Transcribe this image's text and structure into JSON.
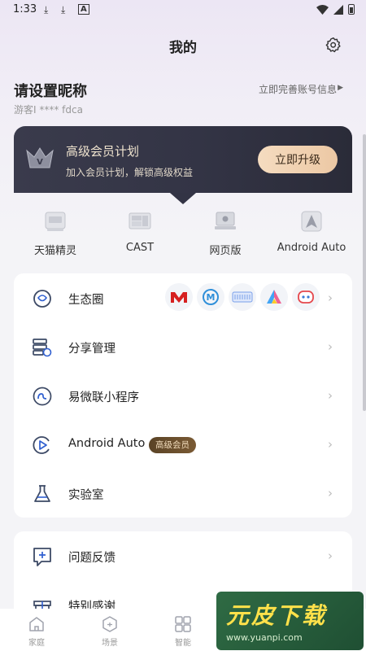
{
  "status_bar": {
    "time": "1:33"
  },
  "header": {
    "title": "我的"
  },
  "profile": {
    "nickname": "请设置昵称",
    "guest_id": "游客I **** fdca",
    "complete_link": "立即完善账号信息"
  },
  "vip": {
    "title": "高级会员计划",
    "subtitle": "加入会员计划，解锁高级权益",
    "button": "立即升级"
  },
  "quick_links": [
    {
      "label": "天猫精灵",
      "icon": "tmall-genie-icon"
    },
    {
      "label": "CAST",
      "icon": "cast-icon"
    },
    {
      "label": "网页版",
      "icon": "web-version-icon"
    },
    {
      "label": "Android Auto",
      "icon": "android-auto-icon"
    }
  ],
  "menu_main": [
    {
      "label": "生态圈",
      "icon": "ecosystem-icon"
    },
    {
      "label": "分享管理",
      "icon": "share-manage-icon"
    },
    {
      "label": "易微联小程序",
      "icon": "mini-program-icon"
    },
    {
      "label": "Android Auto",
      "icon": "android-auto-play-icon",
      "badge": "高级会员"
    },
    {
      "label": "实验室",
      "icon": "lab-flask-icon"
    }
  ],
  "ecosystem_apps": [
    "meross-icon",
    "mi-app-icon",
    "smart-panel-icon",
    "alexa-style-icon",
    "robot-face-icon"
  ],
  "menu_secondary": [
    {
      "label": "问题反馈",
      "icon": "feedback-icon"
    },
    {
      "label": "特别感谢",
      "icon": "gift-icon"
    }
  ],
  "tabs": [
    {
      "label": "家庭",
      "icon": "home-icon"
    },
    {
      "label": "场景",
      "icon": "scene-icon"
    },
    {
      "label": "智能",
      "icon": "smart-icon"
    }
  ],
  "watermark": {
    "brand": "元皮下载",
    "url": "www.yuanpi.com"
  },
  "colors": {
    "accent": "#2f5fd0",
    "vip_gold": "#ecc8a4",
    "vip_dark": "#333445"
  }
}
